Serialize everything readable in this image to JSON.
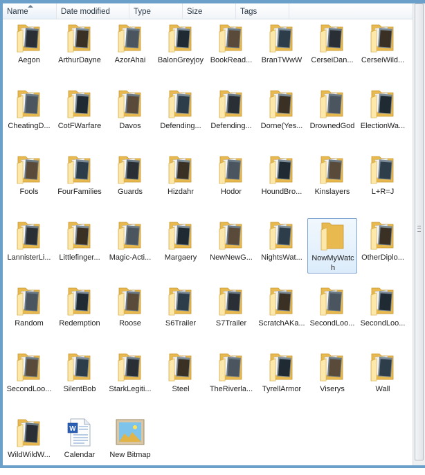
{
  "header": {
    "columns": [
      {
        "label": "Name",
        "sorted": true
      },
      {
        "label": "Date modified"
      },
      {
        "label": "Type"
      },
      {
        "label": "Size"
      },
      {
        "label": "Tags"
      }
    ]
  },
  "items": [
    {
      "label": "Aegon",
      "kind": "folder"
    },
    {
      "label": "ArthurDayne",
      "kind": "folder"
    },
    {
      "label": "AzorAhai",
      "kind": "folder"
    },
    {
      "label": "BalonGreyjoy",
      "kind": "folder"
    },
    {
      "label": "BookRead...",
      "kind": "folder"
    },
    {
      "label": "BranTWwW",
      "kind": "folder"
    },
    {
      "label": "CerseiDan...",
      "kind": "folder"
    },
    {
      "label": "CerseiWild...",
      "kind": "folder"
    },
    {
      "label": "CheatingD...",
      "kind": "folder"
    },
    {
      "label": "CotFWarfare",
      "kind": "folder"
    },
    {
      "label": "Davos",
      "kind": "folder"
    },
    {
      "label": "Defending...",
      "kind": "folder"
    },
    {
      "label": "Defending...",
      "kind": "folder"
    },
    {
      "label": "Dorne(Yes...",
      "kind": "folder"
    },
    {
      "label": "DrownedGod",
      "kind": "folder"
    },
    {
      "label": "ElectionWa...",
      "kind": "folder"
    },
    {
      "label": "Fools",
      "kind": "folder"
    },
    {
      "label": "FourFamilies",
      "kind": "folder"
    },
    {
      "label": "Guards",
      "kind": "folder"
    },
    {
      "label": "Hizdahr",
      "kind": "folder"
    },
    {
      "label": "Hodor",
      "kind": "folder"
    },
    {
      "label": "HoundBro...",
      "kind": "folder"
    },
    {
      "label": "Kinslayers",
      "kind": "folder"
    },
    {
      "label": "L+R=J",
      "kind": "folder"
    },
    {
      "label": "LannisterLi...",
      "kind": "folder"
    },
    {
      "label": "Littlefinger...",
      "kind": "folder"
    },
    {
      "label": "Magic-Acti...",
      "kind": "folder"
    },
    {
      "label": "Margaery",
      "kind": "folder"
    },
    {
      "label": "NewNewG...",
      "kind": "folder"
    },
    {
      "label": "NightsWat...",
      "kind": "folder"
    },
    {
      "label": "NowMyWatch",
      "kind": "folder",
      "selected": true,
      "empty": true
    },
    {
      "label": "OtherDiplo...",
      "kind": "folder"
    },
    {
      "label": "Random",
      "kind": "folder"
    },
    {
      "label": "Redemption",
      "kind": "folder"
    },
    {
      "label": "Roose",
      "kind": "folder"
    },
    {
      "label": "S6Trailer",
      "kind": "folder"
    },
    {
      "label": "S7Trailer",
      "kind": "folder"
    },
    {
      "label": "ScratchAKa...",
      "kind": "folder"
    },
    {
      "label": "SecondLoo...",
      "kind": "folder"
    },
    {
      "label": "SecondLoo...",
      "kind": "folder"
    },
    {
      "label": "SecondLoo...",
      "kind": "folder"
    },
    {
      "label": "SilentBob",
      "kind": "folder"
    },
    {
      "label": "StarkLegiti...",
      "kind": "folder"
    },
    {
      "label": "Steel",
      "kind": "folder"
    },
    {
      "label": "TheRiverla...",
      "kind": "folder"
    },
    {
      "label": "TyrellArmor",
      "kind": "folder"
    },
    {
      "label": "Viserys",
      "kind": "folder"
    },
    {
      "label": "Wall",
      "kind": "folder"
    },
    {
      "label": "WildWildW...",
      "kind": "folder"
    },
    {
      "label": "Calendar",
      "kind": "word-doc"
    },
    {
      "label": "New Bitmap",
      "kind": "bitmap"
    }
  ],
  "colors": {
    "folder_back": "#e8b94f",
    "folder_front": "#fbe29b",
    "selection": "#dcecfb",
    "frame": "#6aa0c9"
  }
}
